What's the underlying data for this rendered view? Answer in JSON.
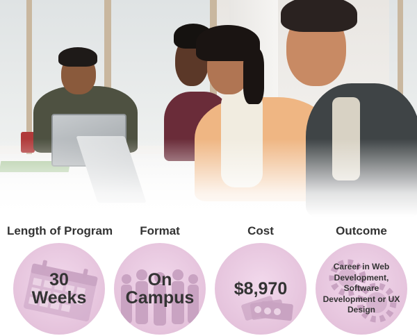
{
  "hero": {
    "image": "students-collaborating-photo"
  },
  "columns": [
    {
      "label": "Length of Program",
      "value": "30 Weeks",
      "icon": "calendar-icon"
    },
    {
      "label": "Format",
      "value": "On Campus",
      "icon": "people-silhouettes-icon"
    },
    {
      "label": "Cost",
      "value": "$8,970",
      "icon": "money-icon"
    },
    {
      "label": "Outcome",
      "value": "Career in Web Development, Software Development or UX Design",
      "icon": "gears-icon"
    }
  ],
  "colors": {
    "circle_fill": "#e5c3dc",
    "decoration": "#c9a3c2",
    "text": "#333333"
  }
}
